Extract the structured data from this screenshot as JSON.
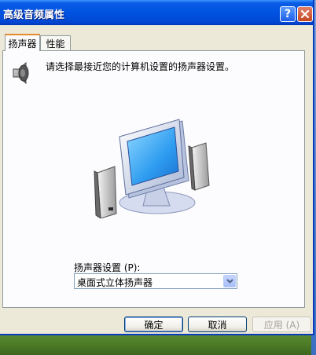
{
  "window": {
    "title": "高级音频属性",
    "help_button": "?",
    "close_button": "✕"
  },
  "tabs": [
    {
      "label": "扬声器",
      "active": true
    },
    {
      "label": "性能",
      "active": false
    }
  ],
  "content": {
    "instruction": "请选择最接近您的计算机设置的扬声器设置。",
    "icons": [
      "speaker-icon",
      "computer-with-speakers-illustration"
    ]
  },
  "speaker_setup": {
    "label": "扬声器设置 (P):",
    "selected": "桌面式立体扬声器"
  },
  "buttons": {
    "ok": "确定",
    "cancel": "取消",
    "apply": "应用 (A)"
  }
}
